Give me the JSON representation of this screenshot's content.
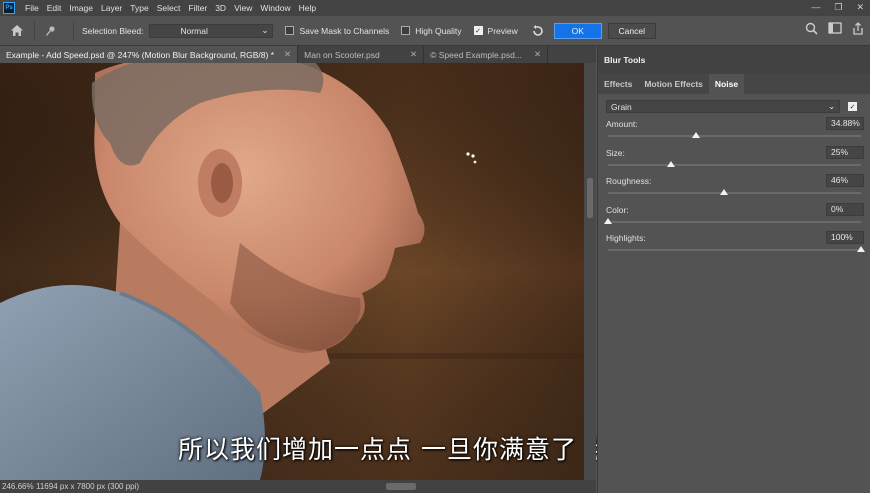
{
  "menu": [
    "File",
    "Edit",
    "Image",
    "Layer",
    "Type",
    "Select",
    "Filter",
    "3D",
    "View",
    "Window",
    "Help"
  ],
  "app_logo": "Ps",
  "options": {
    "selection_bleed_label": "Selection Bleed:",
    "selection_bleed_value": "Normal",
    "save_mask_label": "Save Mask to Channels",
    "save_mask_checked": false,
    "high_quality_label": "High Quality",
    "high_quality_checked": false,
    "preview_label": "Preview",
    "preview_checked": true,
    "ok_label": "OK",
    "cancel_label": "Cancel"
  },
  "doc_tabs": [
    {
      "label": "Example - Add Speed.psd @ 247% (Motion Blur Background, RGB/8) *",
      "active": true
    },
    {
      "label": "Man on Scooter.psd",
      "active": false
    },
    {
      "label": "© Speed Example.psd...",
      "active": false
    }
  ],
  "status": {
    "zoom": "246.66%",
    "doc_info": "11694 px x 7800 px (300 ppi)"
  },
  "subtitle": "所以我们增加一点点 一旦你满意了 点击确认",
  "panel": {
    "title": "Blur Tools",
    "tabs": [
      {
        "label": "Effects",
        "active": false
      },
      {
        "label": "Motion Effects",
        "active": false
      },
      {
        "label": "Noise",
        "active": true
      }
    ],
    "preset": "Grain",
    "preset_checked": true,
    "sliders": [
      {
        "label": "Amount:",
        "value": "34.88%",
        "fraction": 0.349
      },
      {
        "label": "Size:",
        "value": "25%",
        "fraction": 0.25
      },
      {
        "label": "Roughness:",
        "value": "46%",
        "fraction": 0.46
      },
      {
        "label": "Color:",
        "value": "0%",
        "fraction": 0.0
      },
      {
        "label": "Highlights:",
        "value": "100%",
        "fraction": 1.0
      }
    ]
  },
  "colors": {
    "accent": "#1473e6",
    "background": "#535353"
  }
}
